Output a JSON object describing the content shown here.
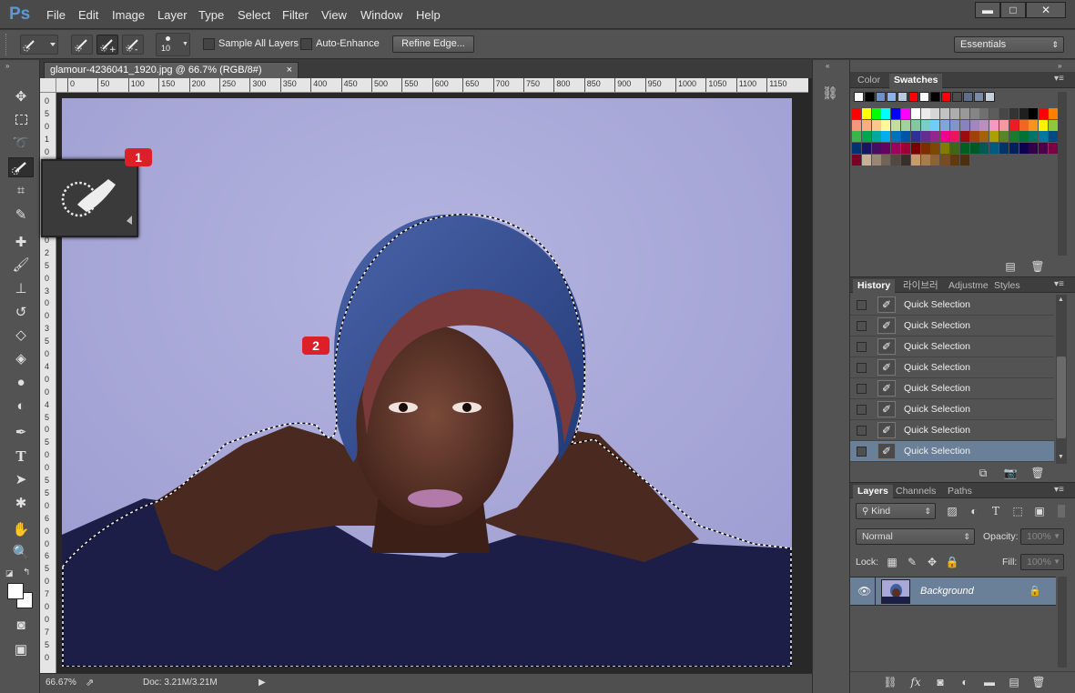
{
  "app": {
    "logo": "Ps"
  },
  "menu": [
    "File",
    "Edit",
    "Image",
    "Layer",
    "Type",
    "Select",
    "Filter",
    "View",
    "Window",
    "Help"
  ],
  "window_controls": {
    "minimize": "▬",
    "maximize": "□",
    "close": "✕"
  },
  "options": {
    "brush_size": "10",
    "sample_all_layers": "Sample All Layers",
    "auto_enhance": "Auto-Enhance",
    "refine_edge": "Refine Edge...",
    "workspace": "Essentials"
  },
  "document": {
    "tab_title": "glamour-4236041_1920.jpg @ 66.7% (RGB/8#)",
    "tab_close": "×",
    "hruler_ticks": [
      "0",
      "50",
      "100",
      "150",
      "200",
      "250",
      "300",
      "350",
      "400",
      "450",
      "500",
      "550",
      "600",
      "650",
      "700",
      "750",
      "800",
      "850",
      "900",
      "950",
      "1000",
      "1050",
      "1100",
      "1150"
    ],
    "vruler_ticks": [
      "0",
      "5",
      "0",
      "1",
      "0",
      "0",
      "1",
      "5",
      "0",
      "2",
      "0",
      "0",
      "2",
      "5",
      "0",
      "3",
      "0",
      "0",
      "3",
      "5",
      "0",
      "4",
      "0",
      "0",
      "4",
      "5",
      "0",
      "5",
      "0",
      "0",
      "5",
      "5",
      "0",
      "6",
      "0",
      "0",
      "6",
      "5",
      "0",
      "7",
      "0",
      "0",
      "7",
      "5",
      "0"
    ],
    "zoom": "66.67%",
    "doc_info": "Doc: 3.21M/3.21M"
  },
  "callouts": {
    "one": "1",
    "two": "2"
  },
  "swatches_panel": {
    "tabs": [
      "Color",
      "Swatches"
    ],
    "recent": [
      "#ffffff",
      "#000000",
      "#6d8fcf",
      "#8bb3e8",
      "#b9c9e0",
      "#ff0000",
      "#ffffff",
      "#000000",
      "#ff0000",
      "#4d4d4d",
      "#5d6f8c",
      "#7c8aa8",
      "#c7d0da"
    ],
    "grid": [
      [
        "#ff0000",
        "#ffff00",
        "#00ff00",
        "#00ffff",
        "#0000ff",
        "#ff00ff",
        "#ffffff",
        "#ebebeb",
        "#d6d6d6",
        "#c2c2c2",
        "#adadad",
        "#999999",
        "#858585",
        "#707070",
        "#5c5c5c",
        "#474747",
        "#333333",
        "#1f1f1f",
        "#000000",
        "#ff0000",
        "#ff7f00"
      ],
      [
        "#f7977a",
        "#f9ad81",
        "#fdc68a",
        "#fff79a",
        "#c4df9b",
        "#a2d39c",
        "#82ca9d",
        "#7bcdc8",
        "#6ecff6",
        "#7ea7d8",
        "#8493ca",
        "#8882be",
        "#a187be",
        "#bc8dbf",
        "#f49ac2",
        "#f6989d",
        "#ed1c24",
        "#f26522",
        "#f7941d",
        "#fff200",
        "#8dc63f"
      ],
      [
        "#39b54a",
        "#00a651",
        "#00a99d",
        "#00aeef",
        "#0072bc",
        "#0054a6",
        "#2e3192",
        "#662d91",
        "#92278f",
        "#ec008c",
        "#ed145b",
        "#9e0b0f",
        "#a0410d",
        "#a36209",
        "#aba000",
        "#598527",
        "#1a7b30",
        "#007236",
        "#00746b",
        "#0076a3",
        "#004b80"
      ],
      [
        "#003471",
        "#1b1464",
        "#440e62",
        "#630460",
        "#9e005d",
        "#9e0039",
        "#790000",
        "#7b2e00",
        "#7d4900",
        "#827b00",
        "#406618",
        "#005e20",
        "#005826",
        "#005952",
        "#005b7f",
        "#003663",
        "#002157",
        "#0d004c",
        "#32004b",
        "#4b0049",
        "#7b0046"
      ],
      [
        "#7a0026",
        "#c7b299",
        "#998675",
        "#736357",
        "#534741",
        "#37302a",
        "#c69c6d",
        "#a67c52",
        "#8c6239",
        "#754c24",
        "#603913",
        "#4c2f0f"
      ]
    ],
    "new_icon": "new-swatch-icon",
    "delete_icon": "trash-icon"
  },
  "history_panel": {
    "tabs": [
      "History",
      "라이브러",
      "Adjustme",
      "Styles"
    ],
    "items": [
      "Quick Selection",
      "Quick Selection",
      "Quick Selection",
      "Quick Selection",
      "Quick Selection",
      "Quick Selection",
      "Quick Selection",
      "Quick Selection"
    ],
    "selected_index": 7
  },
  "layers_panel": {
    "tabs": [
      "Layers",
      "Channels",
      "Paths"
    ],
    "filter_label": "Kind",
    "blend_mode": "Normal",
    "opacity_label": "Opacity:",
    "opacity_value": "100%",
    "lock_label": "Lock:",
    "fill_label": "Fill:",
    "fill_value": "100%",
    "layers": [
      {
        "name": "Background",
        "visible": true,
        "locked": true
      }
    ]
  },
  "colors": {
    "accent": "#6a7f98",
    "canvas_bg": "#a9a8d6",
    "callout": "#dd1f28"
  }
}
